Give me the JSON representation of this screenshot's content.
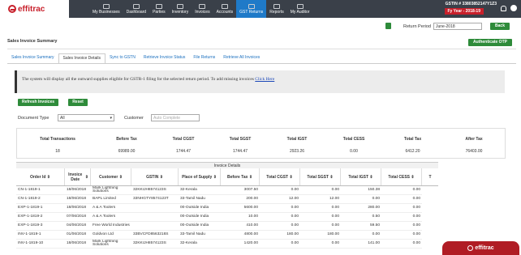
{
  "brand": {
    "name": "effitrac"
  },
  "nav": [
    {
      "label": "My Businesses",
      "icon": "briefcase-icon"
    },
    {
      "label": "Dashboard",
      "icon": "dashboard-icon"
    },
    {
      "label": "Parties",
      "icon": "parties-icon"
    },
    {
      "label": "Inventory",
      "icon": "inventory-icon"
    },
    {
      "label": "Invoices",
      "icon": "invoice-icon"
    },
    {
      "label": "Accounts",
      "icon": "accounts-icon"
    },
    {
      "label": "GST Returns",
      "icon": "gst-icon"
    },
    {
      "label": "Reports",
      "icon": "reports-icon"
    },
    {
      "label": "My Auditor",
      "icon": "auditor-icon"
    }
  ],
  "header": {
    "gstin": "GSTIN # 33803852147Y1Z3",
    "fy": "Fy Year - 2018-19"
  },
  "period": {
    "label": "Return Period",
    "value": "June-2018",
    "back": "Back"
  },
  "page": {
    "title": "Sales Invoice Summary",
    "auth_button": "Authenticate OTP"
  },
  "tabs": [
    "Sales Invoice Summary",
    "Sales Invoice Details",
    "Sync to GSTN",
    "Retrieve Invoice Status",
    "File Returns",
    "Retrieve All Invoices"
  ],
  "info": {
    "text": "The system will display all the outward supplies eligible for GSTR-1 filing for the selected return period. To add missing invoices ",
    "link": "Click Here"
  },
  "actions": {
    "refresh": "Refresh Invoices",
    "reset": "Reset"
  },
  "filters": {
    "doc_type_label": "Document Type",
    "doc_type_value": "All",
    "customer_label": "Customer",
    "customer_placeholder": "Auto Complete"
  },
  "summary": {
    "headers": [
      "Total Transactions",
      "Before Tax",
      "Total CGST",
      "Total SGST",
      "Total IGST",
      "Total CESS",
      "Total Tax",
      "After Tax"
    ],
    "values": [
      "18",
      "69989.00",
      "1744.47",
      "1744.47",
      "2923.26",
      "0.00",
      "6412.20",
      "76403.00"
    ]
  },
  "grid": {
    "title": "Invoice Details",
    "headers": [
      "Order Id",
      "Invoice Date",
      "Customer",
      "GSTIN",
      "Place of Supply",
      "Before Tax",
      "Total CGST",
      "Total SGST",
      "Total IGST",
      "Total CESS",
      "T"
    ],
    "rows": [
      [
        "CN-1-1819-1",
        "18/06/2018",
        "Mark Lightning Solutions",
        "32KKIJH8574123S",
        "32-Kerala",
        "3007.50",
        "0.00",
        "0.00",
        "150.38",
        "0.00"
      ],
      [
        "CN-1-1819-2",
        "18/06/2018",
        "BAPL Limited",
        "33NHGTY8574123T",
        "33-Tamil Nadu",
        "200.00",
        "12.00",
        "12.00",
        "0.00",
        "0.00"
      ],
      [
        "EXP-1-1819-1",
        "18/06/2018",
        "A & A Toolers",
        "",
        "00-Outside India",
        "5600.00",
        "0.00",
        "0.00",
        "280.00",
        "0.00"
      ],
      [
        "EXP-1-1819-2",
        "07/06/2018",
        "A & A Toolers",
        "",
        "00-Outside India",
        "10.00",
        "0.00",
        "0.00",
        "0.50",
        "0.00"
      ],
      [
        "EXP-1-1819-3",
        "04/06/2018",
        "Free World Industries",
        "",
        "00-Outside India",
        "410.00",
        "0.00",
        "0.00",
        "59.50",
        "0.00"
      ],
      [
        "INV-1-1819-1",
        "01/06/2018",
        "Goldvon Ltd",
        "33BVCFD8563218S",
        "33-Tamil Nadu",
        "4800.00",
        "180.00",
        "180.00",
        "0.00",
        "0.00"
      ],
      [
        "INV-1-1819-10",
        "18/06/2018",
        "Mark Lightning Solutions",
        "32KKIJH8574123S",
        "32-Kerala",
        "1420.00",
        "0.00",
        "0.00",
        "141.00",
        "0.00"
      ]
    ]
  }
}
